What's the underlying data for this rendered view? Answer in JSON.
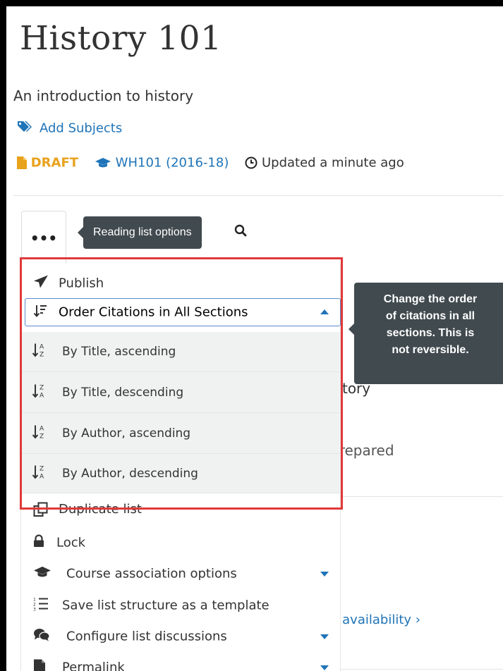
{
  "page": {
    "title": "History 101",
    "subtitle": "An introduction to history",
    "add_subjects": "Add Subjects",
    "status": "DRAFT",
    "course": "WH101 (2016-18)",
    "updated": "Updated a minute ago"
  },
  "toolbar": {
    "options_label": "•••",
    "tooltip": "Reading list options"
  },
  "background": {
    "r_fragment": "r",
    "istory_fragment": "istory",
    "prepared_fragment": "Prepared",
    "availability_fragment": "k availability"
  },
  "menu": {
    "publish": "Publish",
    "order": "Order Citations in All Sections",
    "sort_items": [
      "By Title, ascending",
      "By Title, descending",
      "By Author, ascending",
      "By Author, descending"
    ],
    "duplicate": "Duplicate list",
    "lock": "Lock",
    "course_assoc": "Course association options",
    "save_template": "Save list structure as a template",
    "discussions": "Configure list discussions",
    "permalink": "Permalink"
  },
  "order_tooltip": {
    "lines": [
      "Change the order",
      "of citations in all",
      "sections. This is",
      "not reversible."
    ]
  },
  "colors": {
    "link": "#1f74b8",
    "draft": "#e8a21c",
    "tooltip_bg": "#414a4f",
    "highlight_border": "#e0393a"
  }
}
